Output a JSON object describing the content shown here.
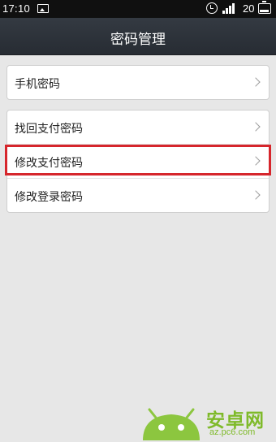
{
  "status_bar": {
    "time": "17:10",
    "battery_level": "20",
    "icons": [
      "gallery-icon",
      "alarm-icon",
      "signal-icon",
      "battery-icon"
    ]
  },
  "header": {
    "title": "密码管理"
  },
  "groups": [
    {
      "items": [
        {
          "label": "手机密码",
          "icon": "chevron-right-icon"
        }
      ]
    },
    {
      "items": [
        {
          "label": "找回支付密码",
          "icon": "chevron-right-icon"
        },
        {
          "label": "修改支付密码",
          "icon": "chevron-right-icon",
          "highlighted": true
        },
        {
          "label": "修改登录密码",
          "icon": "chevron-right-icon"
        }
      ]
    }
  ],
  "watermark": {
    "brand": "安卓网",
    "url": "az.pc6.com"
  },
  "colors": {
    "background": "#e7e7e7",
    "header": "#2e343b",
    "highlight": "#d6262c",
    "watermark": "#7fba2a"
  }
}
